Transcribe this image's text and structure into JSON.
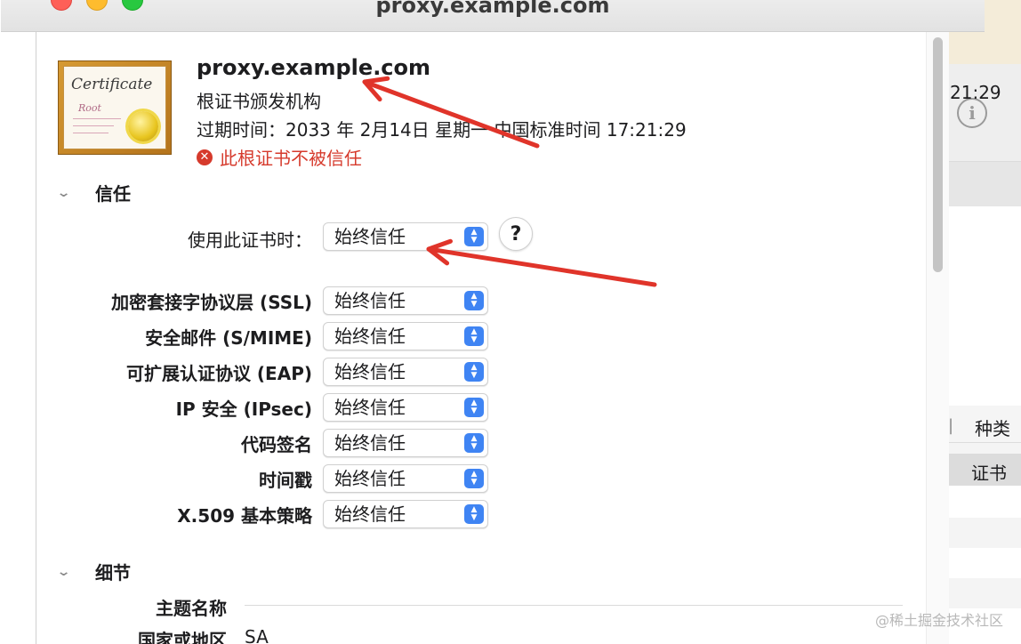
{
  "window": {
    "title": "proxy.example.com"
  },
  "certificate": {
    "icon": "certificate-icon",
    "icon_text": "Certificate",
    "icon_subtext": "Root",
    "name": "proxy.example.com",
    "kind": "根证书颁发机构",
    "expiry": "过期时间：2033 年 2月14日 星期一 中国标准时间 17:21:29",
    "warning": "此根证书不被信任",
    "warning_icon": "x-circle-icon",
    "warning_color": "#d63a2c"
  },
  "trust": {
    "section_label": "信任",
    "use_label": "使用此证书时：",
    "use_value": "始终信任",
    "help_label": "?",
    "rows": [
      {
        "label": "加密套接字协议层 (SSL)",
        "value": "始终信任"
      },
      {
        "label": "安全邮件 (S/MIME)",
        "value": "始终信任"
      },
      {
        "label": "可扩展认证协议 (EAP)",
        "value": "始终信任"
      },
      {
        "label": "IP 安全 (IPsec)",
        "value": "始终信任"
      },
      {
        "label": "代码签名",
        "value": "始终信任"
      },
      {
        "label": "时间戳",
        "value": "始终信任"
      },
      {
        "label": "X.509 基本策略",
        "value": "始终信任"
      }
    ]
  },
  "details": {
    "section_label": "细节",
    "subject_label": "主题名称",
    "country_label": "国家或地区",
    "country_value": "SA"
  },
  "background_app": {
    "time_fragment": "21:29",
    "column_label": "种类",
    "row_label": "证书",
    "info_icon": "info-icon"
  },
  "annotation": {
    "arrow_color": "#e0342a"
  },
  "accent_color": "#3f84f3",
  "watermark": "@稀土掘金技术社区"
}
